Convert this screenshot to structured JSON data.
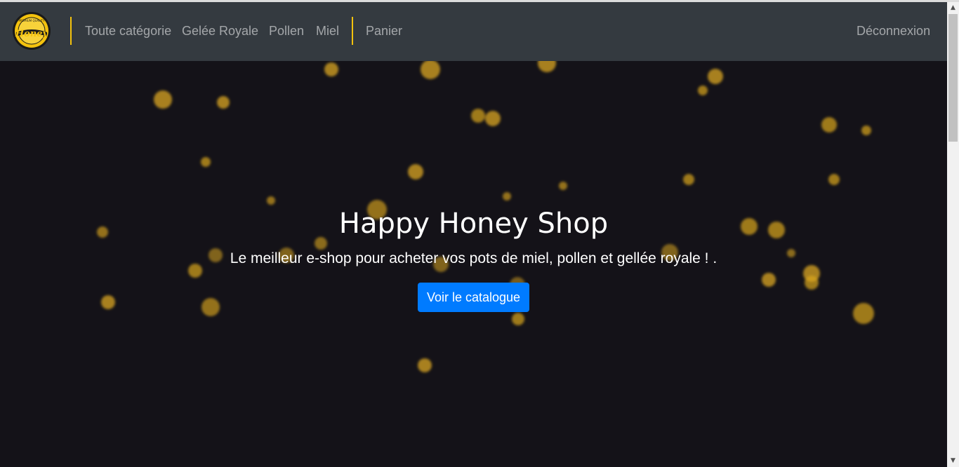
{
  "brand": {
    "logo_text": "Honey",
    "logo_ribbon": "PREMIUM QUALITY"
  },
  "nav": {
    "items": [
      {
        "label": "Toute catégorie"
      },
      {
        "label": "Gelée Royale"
      },
      {
        "label": "Pollen"
      },
      {
        "label": "Miel"
      }
    ],
    "cart_label": "Panier",
    "logout_label": "Déconnexion"
  },
  "hero": {
    "title": "Happy Honey Shop",
    "subtitle": "Le meilleur e-shop pour acheter vos pots de miel, pollen et gellée royale ! .",
    "button_label": "Voir le catalogue"
  },
  "colors": {
    "navbar_bg": "#343a40",
    "hero_bg": "#141218",
    "accent_gold": "#f4c20d",
    "button_blue": "#007bff",
    "bokeh_gold": "#d9a520"
  },
  "icons": {
    "logo": "honey-jar-badge",
    "scroll_up": "triangle-up-icon",
    "scroll_down": "triangle-down-icon"
  }
}
